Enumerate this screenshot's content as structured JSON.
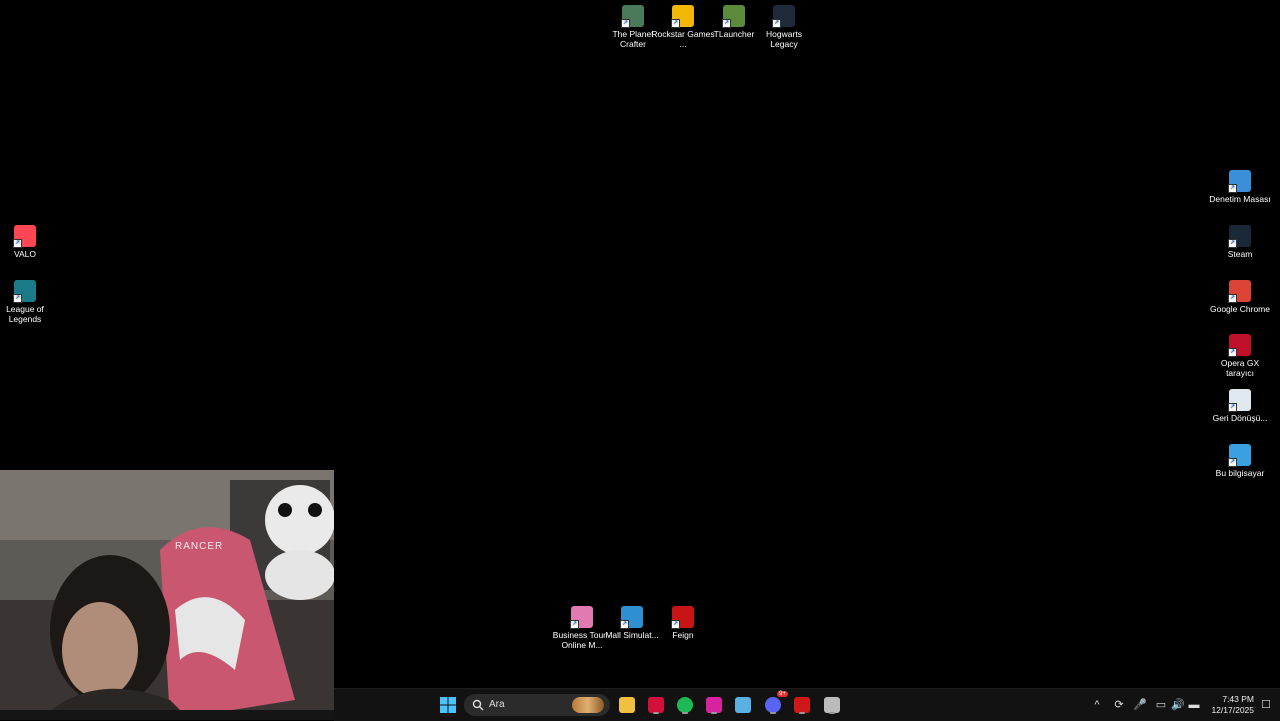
{
  "desktop": {
    "icons": [
      {
        "label": "The Planet Crafter",
        "icon": "planet-icon",
        "color": "#4a7a5a"
      },
      {
        "label": "Rockstar Games ...",
        "icon": "rockstar-icon",
        "color": "#f2b705"
      },
      {
        "label": "TLauncher",
        "icon": "minecraft-block-icon",
        "color": "#5a8a3a"
      },
      {
        "label": "Hogwarts Legacy",
        "icon": "hogwarts-icon",
        "color": "#1e2a3a"
      },
      {
        "label": "VALO",
        "icon": "valorant-icon",
        "color": "#ff4655"
      },
      {
        "label": "League of Legends",
        "icon": "league-icon",
        "color": "#1a7a8a"
      },
      {
        "label": "Denetim Masası",
        "icon": "control-panel-icon",
        "color": "#3a8fd8"
      },
      {
        "label": "Steam",
        "icon": "steam-icon",
        "color": "#1b2838"
      },
      {
        "label": "Google Chrome",
        "icon": "chrome-icon",
        "color": "#db4437"
      },
      {
        "label": "Opera GX tarayıcı",
        "icon": "opera-gx-icon",
        "color": "#c0102a"
      },
      {
        "label": "Geri Dönüşü...",
        "icon": "recycle-bin-icon",
        "color": "#dfe8ef"
      },
      {
        "label": "Bu bilgisayar",
        "icon": "computer-icon",
        "color": "#3aa0e0"
      },
      {
        "label": "Business Tour - Online M...",
        "icon": "business-tour-icon",
        "color": "#e07ab0"
      },
      {
        "label": "Mall Simulat...",
        "icon": "mall-simulator-icon",
        "color": "#2f8fd0"
      },
      {
        "label": "Feign",
        "icon": "feign-icon",
        "color": "#c81414"
      }
    ]
  },
  "webcam": {
    "chair_text": "RANCER"
  },
  "taskbar": {
    "search_placeholder": "Ara",
    "apps": [
      {
        "name": "file-explorer-icon",
        "color": "#f0c040"
      },
      {
        "name": "opera-gx-icon",
        "color": "#d0103a"
      },
      {
        "name": "spotify-icon",
        "color": "#1db954"
      },
      {
        "name": "instagram-icon",
        "color": "#d6249f"
      },
      {
        "name": "snipping-tool-icon",
        "color": "#5ab0e0"
      },
      {
        "name": "discord-icon",
        "color": "#5865f2"
      },
      {
        "name": "feign-icon",
        "color": "#d01818"
      },
      {
        "name": "settings-icon",
        "color": "#bbbbbb"
      }
    ],
    "discord_badge": "9+",
    "time": "7:43 PM",
    "date": "12/17/2025"
  }
}
